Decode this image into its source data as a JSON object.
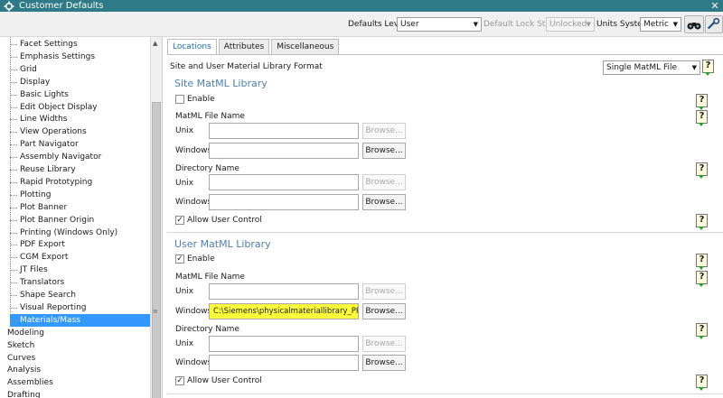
{
  "window": {
    "title": "Customer Defaults",
    "close_glyph": "✕"
  },
  "toolbar": {
    "defaults_level_label": "Defaults Level",
    "defaults_level_value": "User",
    "default_lock_state_label": "Default Lock State",
    "default_lock_state_value": "Unlocked",
    "units_system_label": "Units System",
    "units_system_value": "Metric"
  },
  "sidebar": {
    "children": [
      "Facet Settings",
      "Emphasis Settings",
      "Grid",
      "Display",
      "Basic Lights",
      "Edit Object Display",
      "Line Widths",
      "View Operations",
      "Part Navigator",
      "Assembly Navigator",
      "Reuse Library",
      "Rapid Prototyping",
      "Plotting",
      "Plot Banner",
      "Plot Banner Origin",
      "Printing (Windows Only)",
      "PDF Export",
      "CGM Export",
      "JT Files",
      "Translators",
      "Shape Search",
      "Visual Reporting",
      "Materials/Mass"
    ],
    "selected": "Materials/Mass",
    "roots": [
      "Modeling",
      "Sketch",
      "Curves",
      "Analysis",
      "Assemblies",
      "Drafting"
    ]
  },
  "tabs": [
    "Locations",
    "Attributes",
    "Miscellaneous"
  ],
  "main": {
    "format_label": "Site and User Material Library Format",
    "format_value": "Single MatML File",
    "site": {
      "title": "Site MatML Library",
      "enable_label": "Enable",
      "enable_checked": false,
      "file_name_label": "MatML File Name",
      "unix_label": "Unix",
      "unix_value": "",
      "windows_label": "Windows",
      "windows_value": "",
      "dir_name_label": "Directory Name",
      "dir_unix_value": "",
      "dir_windows_value": "",
      "allow_label": "Allow User Control",
      "allow_checked": true
    },
    "user": {
      "title": "User MatML Library",
      "enable_label": "Enable",
      "enable_checked": true,
      "file_name_label": "MatML File Name",
      "unix_label": "Unix",
      "unix_value": "",
      "windows_label": "Windows",
      "windows_value": "C:\\Siemens\\physicalmateriallibrary_PRUEBA",
      "dir_name_label": "Directory Name",
      "dir_unix_value": "",
      "dir_windows_value": "",
      "allow_label": "Allow User Control",
      "allow_checked": true
    },
    "browse_label": "Browse...",
    "help_glyph": "?",
    "check_glyph": "✓"
  },
  "colors": {
    "titlebar": "#2e7a86",
    "selection": "#3399ff",
    "highlight": "#ffff3c",
    "section_title": "#4f7fb0"
  }
}
